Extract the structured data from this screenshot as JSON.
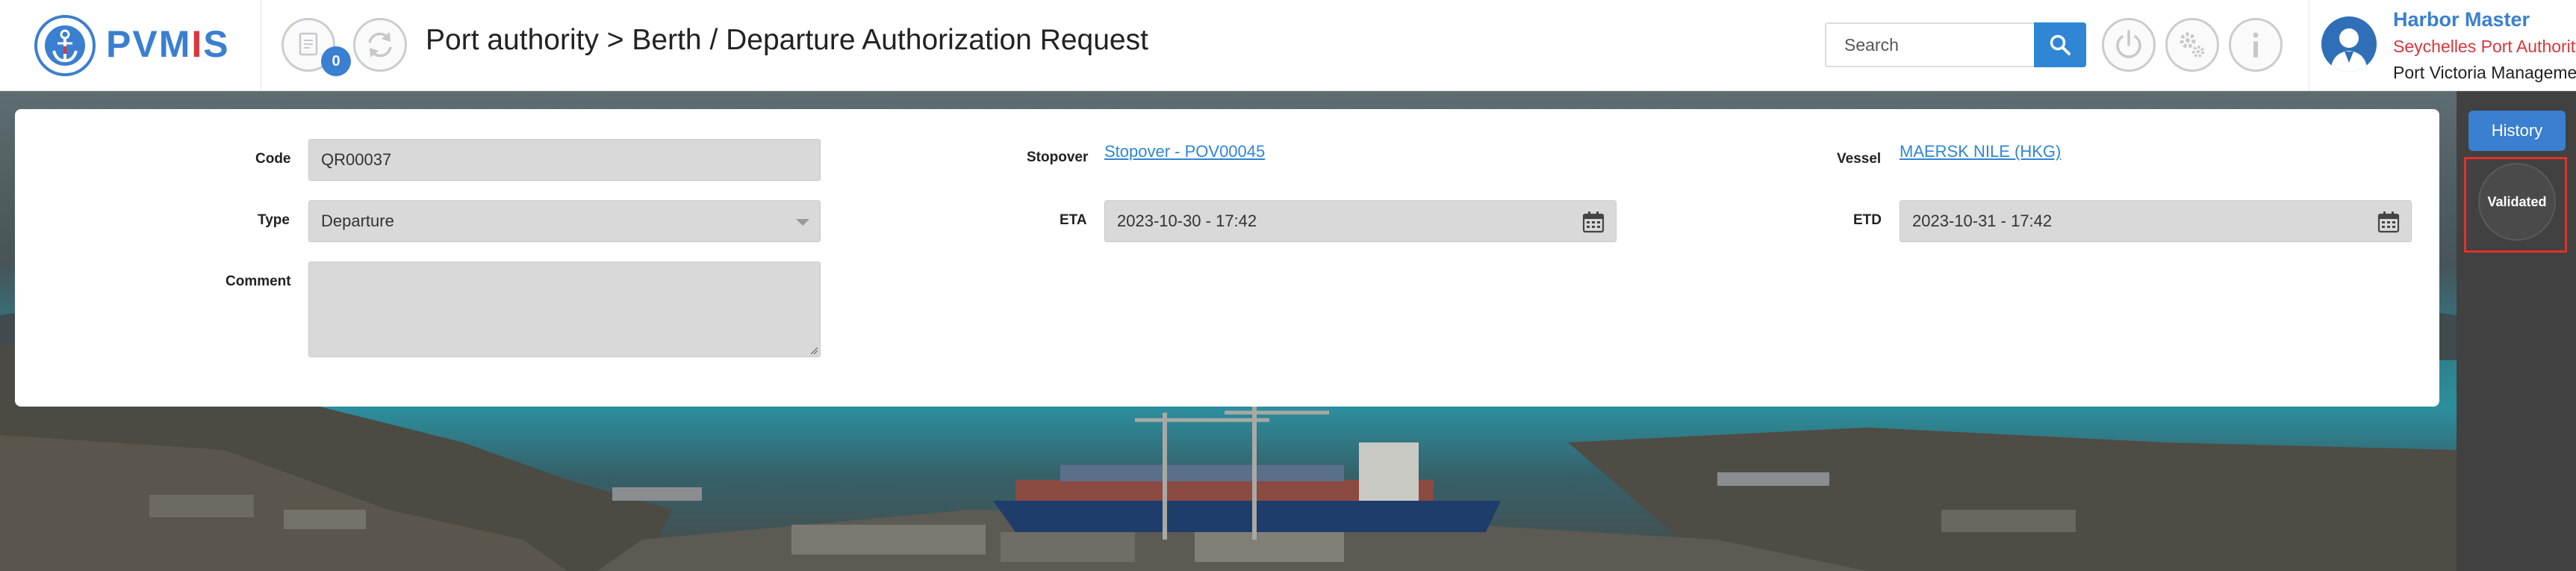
{
  "header": {
    "logo": {
      "text_main": "PVM",
      "text_accent": "I",
      "text_end": "S"
    },
    "notification_count": "0",
    "title": "Port authority > Berth / Departure Authorization Request",
    "search": {
      "placeholder": "Search",
      "value": ""
    },
    "icons": [
      "document-icon",
      "refresh-icon",
      "power-icon",
      "settings-icon",
      "info-icon",
      "search-icon"
    ],
    "user": {
      "role": "Harbor Master",
      "organization": "Seychelles Port Authority",
      "unit": "Port Victoria Management"
    }
  },
  "form": {
    "code": {
      "label": "Code",
      "value": "QR00037"
    },
    "type": {
      "label": "Type",
      "value": "Departure"
    },
    "comment": {
      "label": "Comment",
      "value": ""
    },
    "stopover": {
      "label": "Stopover",
      "value": "Stopover - POV00045"
    },
    "eta": {
      "label": "ETA",
      "value": "2023-10-30 - 17:42"
    },
    "vessel": {
      "label": "Vessel",
      "value": "MAERSK NILE (HKG)"
    },
    "etd": {
      "label": "ETD",
      "value": "2023-10-31 - 17:42"
    }
  },
  "sidebar": {
    "history_label": "History",
    "status_label": "Validated"
  },
  "colors": {
    "brand_blue": "#3a7fd0",
    "brand_red": "#d9363e",
    "link_blue": "#2f86d4",
    "highlight_red": "#e0322a"
  }
}
